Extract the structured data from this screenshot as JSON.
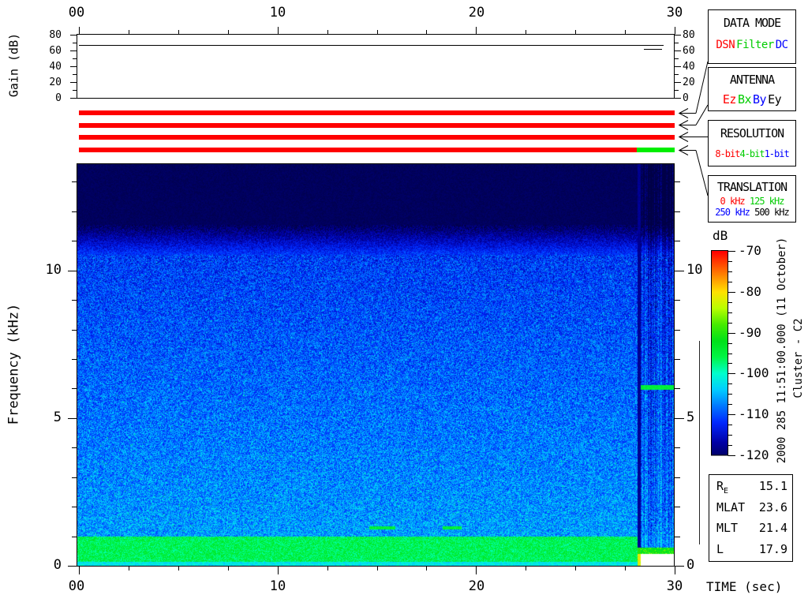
{
  "gain_panel": {
    "ylabel": "Gain (dB)",
    "top_axis_ticks": [
      "00",
      "10",
      "20",
      "30"
    ],
    "y_tick_labels": [
      "80",
      "60",
      "40",
      "20",
      "0"
    ]
  },
  "spectrogram": {
    "ylabel": "Frequency (kHz)",
    "y_tick_labels": [
      "10",
      "5",
      "0"
    ],
    "x_tick_labels": [
      "00",
      "10",
      "20",
      "30"
    ],
    "xlabel": "TIME (sec)"
  },
  "colorbar": {
    "title": "dB",
    "tick_labels": [
      "-70",
      "-80",
      "-90",
      "-100",
      "-110",
      "-120"
    ]
  },
  "annotations": {
    "datetime_line": "2000 285 11:51:00.000 (11 October)",
    "spacecraft_line": "Cluster - C2"
  },
  "info_box": {
    "rows": [
      {
        "label": "R",
        "subscript": "E",
        "value": "15.1"
      },
      {
        "label": "MLAT",
        "subscript": "",
        "value": "23.6"
      },
      {
        "label": "MLT",
        "subscript": "",
        "value": "21.4"
      },
      {
        "label": "L",
        "subscript": "",
        "value": "17.9"
      }
    ]
  },
  "boxes": {
    "data_mode": {
      "title": "DATA MODE",
      "values": [
        {
          "label": "DSN",
          "color": "#ff0000"
        },
        {
          "label": "Filter",
          "color": "#00cc00"
        },
        {
          "label": "DC",
          "color": "#0000ff"
        }
      ]
    },
    "antenna": {
      "title": "ANTENNA",
      "values": [
        {
          "label": "Ez",
          "color": "#ff0000"
        },
        {
          "label": "Bx",
          "color": "#00cc00"
        },
        {
          "label": "By",
          "color": "#0000ff"
        },
        {
          "label": "Ey",
          "color": "#000000"
        }
      ]
    },
    "resolution": {
      "title": "RESOLUTION",
      "values": [
        {
          "label": "8-bit",
          "color": "#ff0000"
        },
        {
          "label": "4-bit",
          "color": "#00cc00"
        },
        {
          "label": "1-bit",
          "color": "#0000ff"
        }
      ]
    },
    "translation": {
      "title": "TRANSLATION",
      "values": [
        {
          "label": "0 kHz",
          "color": "#ff0000"
        },
        {
          "label": "125 kHz",
          "color": "#00cc00"
        },
        {
          "label": "250 kHz",
          "color": "#0000ff"
        },
        {
          "label": "500 kHz",
          "color": "#000000"
        }
      ]
    }
  },
  "status_bars": {
    "bars": [
      {
        "name": "data-mode-bar",
        "segments": [
          {
            "from_sec": 0,
            "to_sec": 30,
            "color": "#ff0000"
          }
        ]
      },
      {
        "name": "antenna-bar",
        "segments": [
          {
            "from_sec": 0,
            "to_sec": 30,
            "color": "#ff0000"
          }
        ]
      },
      {
        "name": "resolution-bar",
        "segments": [
          {
            "from_sec": 0,
            "to_sec": 30,
            "color": "#ff0000"
          }
        ]
      },
      {
        "name": "translation-bar",
        "segments": [
          {
            "from_sec": 0,
            "to_sec": 28.1,
            "color": "#ff0000"
          },
          {
            "from_sec": 28.1,
            "to_sec": 30,
            "color": "#00ee00"
          }
        ]
      }
    ]
  },
  "colormap": {
    "db_min": -120,
    "db_max": -70,
    "stops": [
      [
        -122,
        0,
        0,
        70
      ],
      [
        -117,
        0,
        0,
        165
      ],
      [
        -112,
        0,
        40,
        255
      ],
      [
        -108,
        0,
        120,
        255
      ],
      [
        -104,
        0,
        205,
        255
      ],
      [
        -100,
        0,
        255,
        205
      ],
      [
        -96,
        0,
        245,
        70
      ],
      [
        -92,
        0,
        225,
        25
      ],
      [
        -88,
        70,
        235,
        0
      ],
      [
        -84,
        185,
        255,
        0
      ],
      [
        -80,
        255,
        225,
        0
      ],
      [
        -76,
        255,
        135,
        0
      ],
      [
        -72,
        255,
        45,
        0
      ],
      [
        -70,
        255,
        0,
        0
      ]
    ]
  },
  "chart_data": [
    {
      "type": "line",
      "title": "Receiver gain vs time",
      "ylabel": "Gain (dB)",
      "xlim": [
        0,
        30
      ],
      "ylim": [
        0,
        80
      ],
      "x_ticks": [
        0,
        10,
        20,
        30
      ],
      "y_ticks": [
        0,
        20,
        40,
        60,
        80
      ],
      "series": [
        {
          "name": "gain-main",
          "t": [
            0,
            29.4
          ],
          "gain_db": 67
        },
        {
          "name": "gain-step",
          "t": [
            28.4,
            29.3
          ],
          "gain_db": 61
        }
      ]
    },
    {
      "type": "heatmap",
      "title": "Cluster - C2 wideband (WBD) spectrogram",
      "xlabel": "TIME (sec)",
      "ylabel": "Frequency (kHz)",
      "xlim": [
        0,
        30
      ],
      "ylim": [
        0,
        13.6
      ],
      "colorbar_label": "dB",
      "colorbar_range": [
        -120,
        -70
      ],
      "start_time": "2000 285 11:51:00.000 (11 October)",
      "features": {
        "cutoff_khz": 11.05,
        "transition_khz": [
          10.55,
          11.55
        ],
        "noise_floor_db_at_10khz": -111.5,
        "noise_floor_slope_db_per_khz": 0.55,
        "lowband": {
          "f_lo": 0.15,
          "f_hi": 1.0,
          "db": -96
        },
        "mode_change_sec": 28.1,
        "right_segment": {
          "narrowband_khz": 6.05,
          "narrowband_db": -95,
          "lowline_khz": 0.5,
          "lowline_db": -92,
          "gap_f_hi_khz": 0.42
        },
        "dashes": [
          {
            "t0": 14.6,
            "t1": 15.9,
            "f": 1.3
          },
          {
            "t0": 18.3,
            "t1": 19.25,
            "f": 1.3
          }
        ]
      }
    }
  ]
}
